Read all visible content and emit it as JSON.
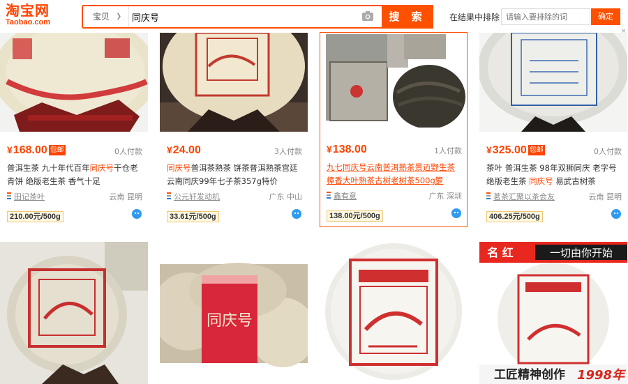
{
  "header": {
    "logo_cn": "淘宝网",
    "logo_en": "Taobao.com",
    "search_scope": "宝贝",
    "search_query": "同庆号",
    "search_button": "搜 索",
    "exclude_label": "在结果中排除",
    "exclude_placeholder": "请输入要排除的词",
    "exclude_button": "确定",
    "close_symbol": "×"
  },
  "currency_symbol": "¥",
  "products": [
    {
      "price": "168.00",
      "badge": "包邮",
      "sales": "0人付款",
      "title_parts": [
        "普洱生茶 九十年代百年",
        "同庆号",
        "干仓老青饼 绝版老生茶 香气十足"
      ],
      "shop": "田记茶叶",
      "location": "云南 昆明",
      "unit_price": "210.00元/500g"
    },
    {
      "price": "24.00",
      "badge": "",
      "sales": "3人付款",
      "title_parts": [
        "",
        "同庆号",
        "普洱茶熟茶 饼茶普洱熟茶宫廷云南同庆99年七子茶357g特价"
      ],
      "shop": "公元轩发动机",
      "location": "广东 中山",
      "unit_price": "33.61元/500g"
    },
    {
      "price": "138.00",
      "badge": "",
      "sales": "1人付款",
      "title_full": "九七同庆号云南普洱熟茶景迈野生茶樟香大叶熟茶古树老树茶500g箩",
      "shop": "鑫有意",
      "location": "广东 深圳",
      "unit_price": "138.00元/500g"
    },
    {
      "price": "325.00",
      "badge": "包邮",
      "sales": "0人付款",
      "title_parts": [
        "茶叶 普洱生茶 98年双狮同庆 老字号绝版老生茶 ",
        "同庆号",
        " 易武古树茶"
      ],
      "shop": "茗茶汇聚以茶会友",
      "location": "云南 昆明",
      "unit_price": "406.25元/500g"
    }
  ],
  "second_row": {
    "card3_label": "同庆号",
    "card4_banner_left": "名 红",
    "card4_banner_right": "一切由你开始",
    "card4_bottom_left": "工匠精神创作",
    "card4_bottom_right": "1998年"
  },
  "colors": {
    "accent": "#ff5000",
    "price": "#ff4400",
    "unit_border": "#f0c870"
  }
}
